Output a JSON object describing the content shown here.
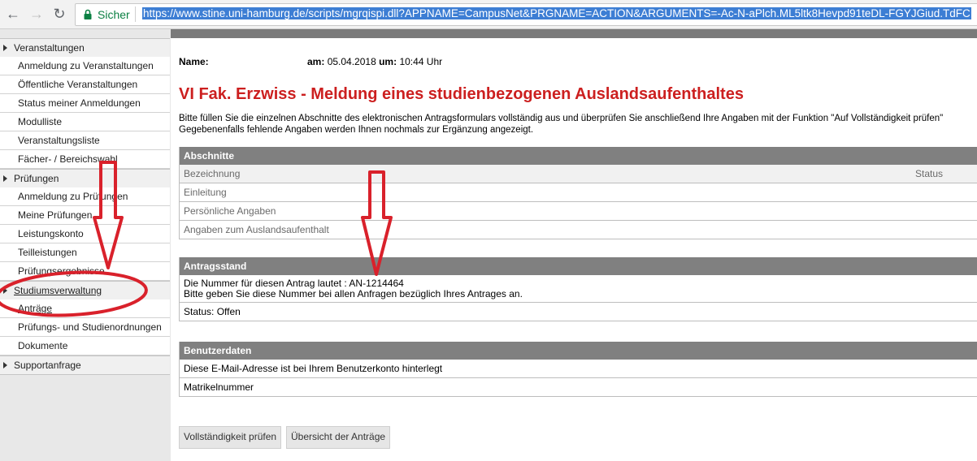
{
  "browser": {
    "secure_label": "Sicher",
    "url": "https://www.stine.uni-hamburg.de/scripts/mgrqispi.dll?APPNAME=CampusNet&PRGNAME=ACTION&ARGUMENTS=-Ac-N-aPlch.ML5ltk8Hevpd91teDL-FGYJGiud.TdFC"
  },
  "sidebar": {
    "sections": [
      {
        "label": "Veranstaltungen",
        "items": [
          "Anmeldung zu Veranstaltungen",
          "Öffentliche Veranstaltungen",
          "Status meiner Anmeldungen",
          "Modulliste",
          "Veranstaltungsliste",
          "Fächer- / Bereichswahl"
        ]
      },
      {
        "label": "Prüfungen",
        "items": [
          "Anmeldung zu Prüfungen",
          "Meine Prüfungen",
          "Leistungskonto",
          "Teilleistungen",
          "Prüfungsergebnisse"
        ]
      },
      {
        "label": "Studiumsverwaltung",
        "items": [
          "Anträge",
          "Prüfungs- und Studienordnungen",
          "Dokumente"
        ]
      },
      {
        "label": "Supportanfrage",
        "items": []
      }
    ]
  },
  "main": {
    "name_label": "Name:",
    "date_prefix": "am:",
    "date": "05.04.2018",
    "time_prefix": "um:",
    "time": "10:44 Uhr",
    "title": "VI Fak. Erzwiss - Meldung eines studienbezogenen Auslandsaufenthaltes",
    "instructions_1": "Bitte füllen Sie die einzelnen Abschnitte des elektronischen Antragsformulars vollständig aus und überprüfen Sie anschließend Ihre Angaben mit der Funktion \"Auf Vollständigkeit prüfen\"",
    "instructions_2": "Gegebenenfalls fehlende Angaben werden Ihnen nochmals zur Ergänzung angezeigt.",
    "sections_box": {
      "header": "Abschnitte",
      "col_name": "Bezeichnung",
      "col_status": "Status",
      "rows": [
        "Einleitung",
        "Persönliche Angaben",
        "Angaben zum Auslandsaufenthalt"
      ]
    },
    "status_box": {
      "header": "Antragsstand",
      "line1": "Die Nummer für diesen Antrag lautet : AN-1214464",
      "line2": "Bitte geben Sie diese Nummer bei allen Anfragen bezüglich Ihres Antrages an.",
      "status": "Status: Offen"
    },
    "user_box": {
      "header": "Benutzerdaten",
      "rows": [
        "Diese E-Mail-Adresse ist bei Ihrem Benutzerkonto hinterlegt",
        "Matrikelnummer"
      ]
    },
    "buttons": {
      "check": "Vollständigkeit prüfen",
      "overview": "Übersicht der Anträge"
    }
  },
  "colors": {
    "title_red": "#cc1f1f",
    "header_grey": "#808080",
    "annotation_red": "#d9212b",
    "secure_green": "#0b8043"
  }
}
